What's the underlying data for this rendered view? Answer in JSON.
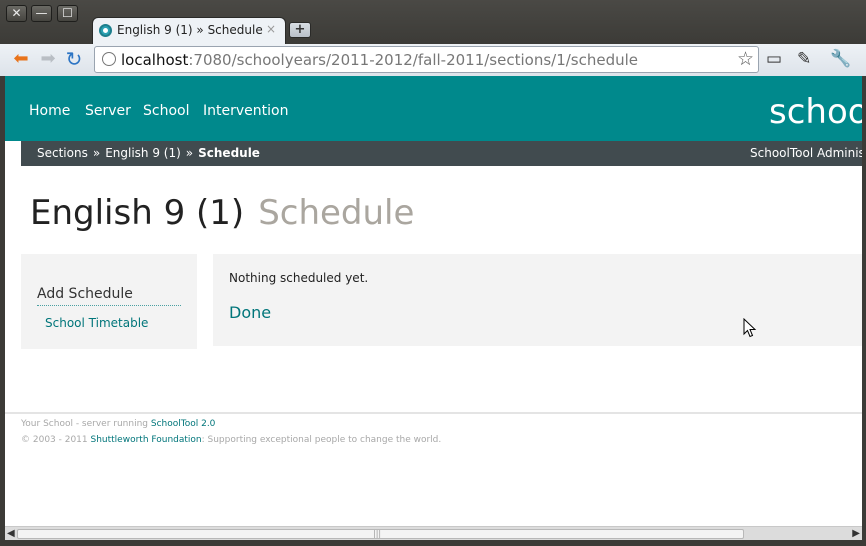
{
  "window": {
    "controls": {
      "close": "✕",
      "minimize": "—",
      "maximize": "☐"
    }
  },
  "tab": {
    "title": "English 9 (1) » Schedule",
    "close": "×",
    "new_tab": "+"
  },
  "toolbar": {
    "url_host": "localhost",
    "url_path": ":7080/schoolyears/2011-2012/fall-2011/sections/1/schedule",
    "icons": [
      "back-icon",
      "forward-icon",
      "reload-icon",
      "page-icon",
      "bookmark-star-icon",
      "page-zoom-icon",
      "pin-icon",
      "wrench-icon"
    ]
  },
  "site": {
    "nav": [
      "Home",
      "Server",
      "School",
      "Intervention"
    ],
    "brand": "schoo",
    "colors": {
      "header": "#00898c",
      "crumb_bar": "#414b4f",
      "link": "#00757a"
    }
  },
  "breadcrumb": {
    "items": [
      "Sections",
      "English 9 (1)",
      "Schedule"
    ],
    "separator": "»",
    "user": "SchoolTool Administ"
  },
  "heading": {
    "title": "English 9 (1)",
    "subtitle": "Schedule"
  },
  "sidebar": {
    "heading": "Add Schedule",
    "link": "School Timetable"
  },
  "content": {
    "message": "Nothing scheduled yet.",
    "done": "Done"
  },
  "footer": {
    "line1_prefix": "Your School - server running ",
    "line1_link": "SchoolTool 2.0",
    "line2_prefix": "© 2003 - 2011 ",
    "line2_link": "Shuttleworth Foundation",
    "line2_suffix": ": Supporting exceptional people to change the world."
  }
}
